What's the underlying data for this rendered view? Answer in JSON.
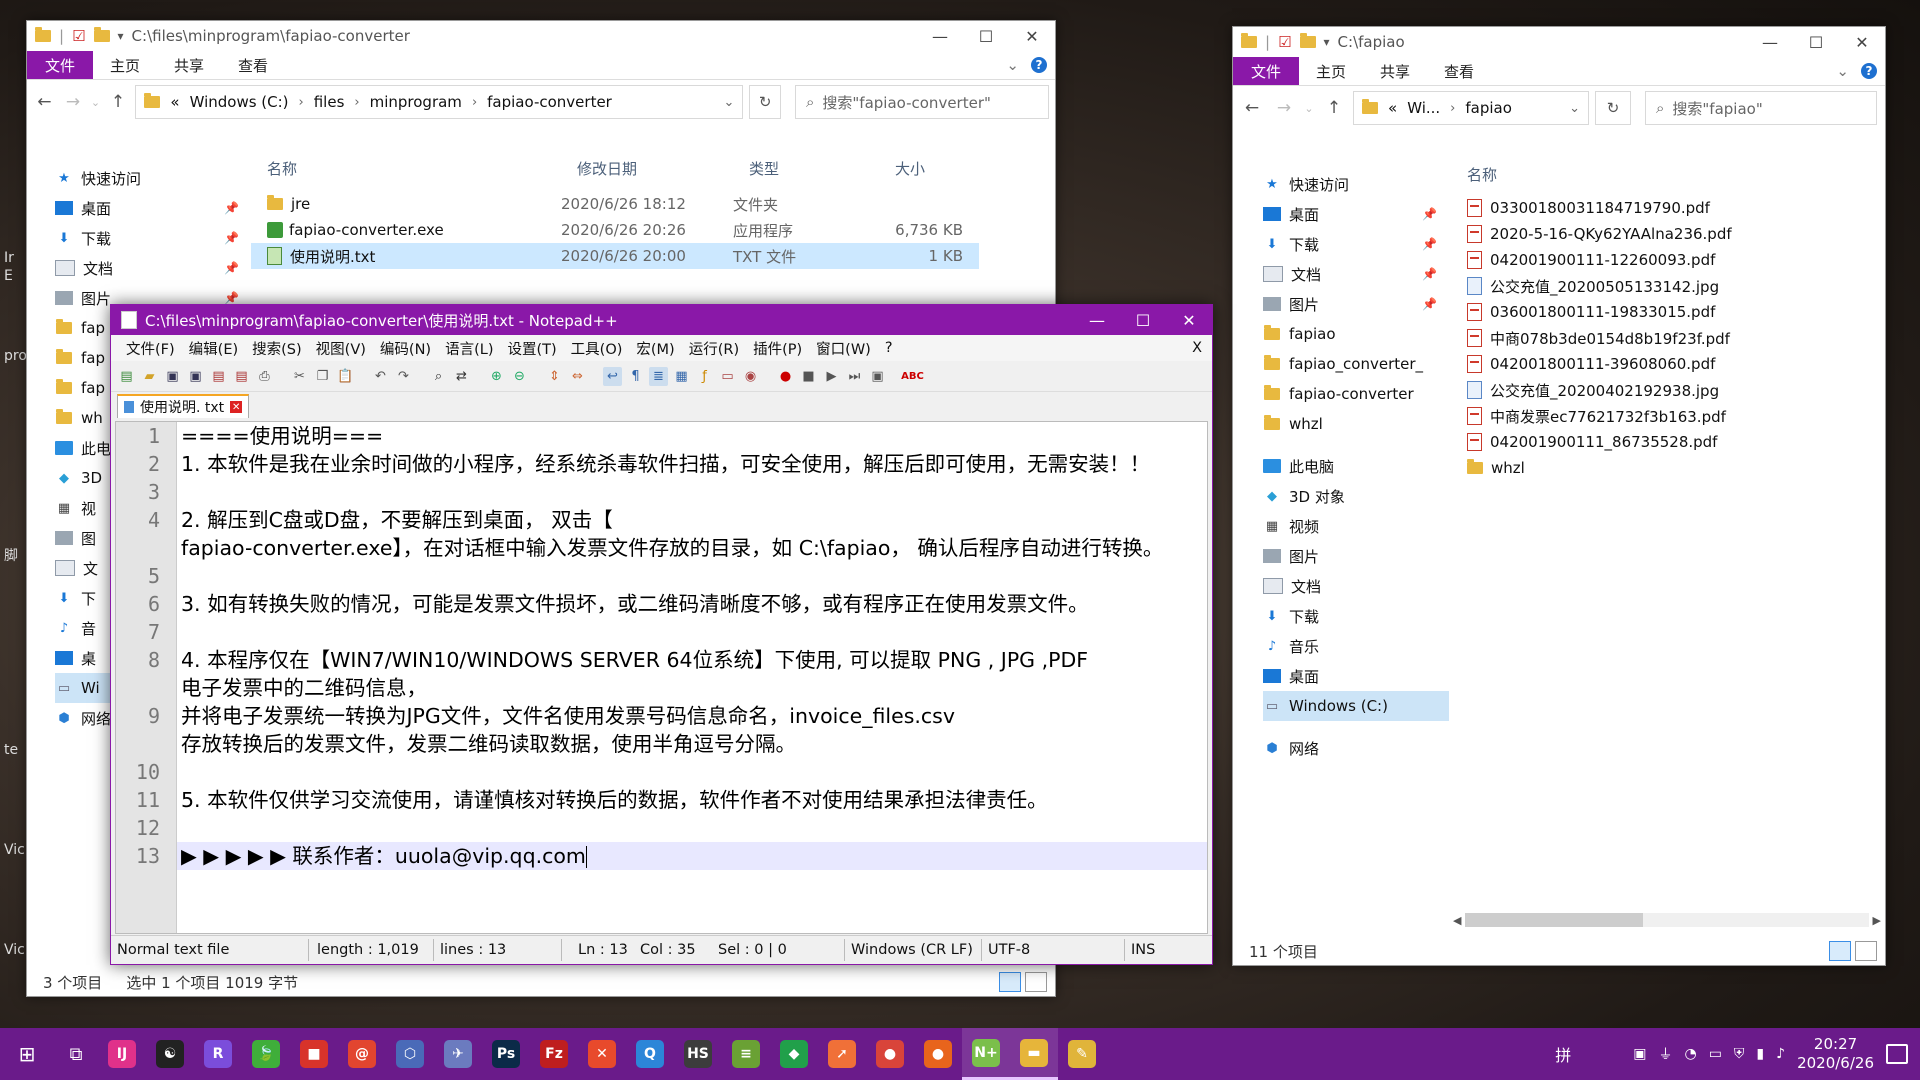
{
  "desktop": {
    "labels": [
      "Ir",
      "E",
      "pro",
      "脚",
      "te",
      "Vic",
      "Vic"
    ]
  },
  "explorer_left": {
    "title": "C:\\files\\minprogram\\fapiao-converter",
    "ribbon": {
      "file": "文件",
      "home": "主页",
      "share": "共享",
      "view": "查看"
    },
    "address": [
      "«",
      "Windows (C:)",
      "files",
      "minprogram",
      "fapiao-converter"
    ],
    "search_placeholder": "搜索\"fapiao-converter\"",
    "columns": {
      "name": "名称",
      "modified": "修改日期",
      "type": "类型",
      "size": "大小"
    },
    "files": [
      {
        "name": "jre",
        "modified": "2020/6/26 18:12",
        "type": "文件夹",
        "size": "",
        "icon": "folder-icon"
      },
      {
        "name": "fapiao-converter.exe",
        "modified": "2020/6/26 20:26",
        "type": "应用程序",
        "size": "6,736 KB",
        "icon": "exe-icon"
      },
      {
        "name": "使用说明.txt",
        "modified": "2020/6/26 20:00",
        "type": "TXT 文件",
        "size": "1 KB",
        "icon": "txt-icon",
        "selected": true
      }
    ],
    "nav": [
      {
        "label": "快速访问",
        "icon": "star-icon",
        "pin": false
      },
      {
        "label": "桌面",
        "icon": "desktop-icon",
        "pin": true
      },
      {
        "label": "下载",
        "icon": "download-icon",
        "pin": true
      },
      {
        "label": "文档",
        "icon": "document-icon",
        "pin": true
      },
      {
        "label": "图片",
        "icon": "picture-icon",
        "pin": true
      },
      {
        "label": "fap",
        "icon": "folder-icon",
        "pin": false
      },
      {
        "label": "fap",
        "icon": "folder-icon",
        "pin": false
      },
      {
        "label": "fap",
        "icon": "folder-icon",
        "pin": false
      },
      {
        "label": "wh",
        "icon": "folder-icon",
        "pin": false
      },
      {
        "label": "此电",
        "icon": "pc-icon",
        "pin": false
      },
      {
        "label": "3D",
        "icon": "cube-icon",
        "pin": false
      },
      {
        "label": "视",
        "icon": "video-icon",
        "pin": false
      },
      {
        "label": "图",
        "icon": "picture-icon",
        "pin": false
      },
      {
        "label": "文",
        "icon": "document-icon",
        "pin": false
      },
      {
        "label": "下",
        "icon": "download-icon",
        "pin": false
      },
      {
        "label": "音",
        "icon": "music-icon",
        "pin": false
      },
      {
        "label": "桌",
        "icon": "desktop-icon",
        "pin": false
      },
      {
        "label": "Wi",
        "icon": "drive-icon",
        "pin": false,
        "selected": true
      },
      {
        "label": "网络",
        "icon": "network-icon",
        "pin": false
      }
    ],
    "status": {
      "count": "3 个项目",
      "selection": "选中 1 个项目  1019 字节"
    }
  },
  "explorer_right": {
    "title": "C:\\fapiao",
    "ribbon": {
      "file": "文件",
      "home": "主页",
      "share": "共享",
      "view": "查看"
    },
    "address": [
      "«",
      "Wi...",
      "fapiao"
    ],
    "search_placeholder": "搜索\"fapiao\"",
    "columns": {
      "name": "名称"
    },
    "files": [
      {
        "name": "03300180031184719790.pdf",
        "icon": "pdf-icon"
      },
      {
        "name": "2020-5-16-QKy62YAAlna236.pdf",
        "icon": "pdf-icon"
      },
      {
        "name": "042001900111-12260093.pdf",
        "icon": "pdf-icon"
      },
      {
        "name": "公交充值_20200505133142.jpg",
        "icon": "jpg-icon"
      },
      {
        "name": "036001800111-19833015.pdf",
        "icon": "pdf-icon"
      },
      {
        "name": "中商078b3de0154d8b19f23f.pdf",
        "icon": "pdf-icon"
      },
      {
        "name": "042001800111-39608060.pdf",
        "icon": "pdf-icon"
      },
      {
        "name": "公交充值_20200402192938.jpg",
        "icon": "jpg-icon"
      },
      {
        "name": "中商发票ec77621732f3b163.pdf",
        "icon": "pdf-icon"
      },
      {
        "name": "042001900111_86735528.pdf",
        "icon": "pdf-icon"
      },
      {
        "name": "whzl",
        "icon": "folder-icon"
      }
    ],
    "nav": [
      {
        "label": "快速访问",
        "icon": "star-icon",
        "pin": false
      },
      {
        "label": "桌面",
        "icon": "desktop-icon",
        "pin": true
      },
      {
        "label": "下载",
        "icon": "download-icon",
        "pin": true
      },
      {
        "label": "文档",
        "icon": "document-icon",
        "pin": true
      },
      {
        "label": "图片",
        "icon": "picture-icon",
        "pin": true
      },
      {
        "label": "fapiao",
        "icon": "folder-icon",
        "pin": false
      },
      {
        "label": "fapiao_converter_",
        "icon": "folder-icon",
        "pin": false
      },
      {
        "label": "fapiao-converter",
        "icon": "folder-icon",
        "pin": false
      },
      {
        "label": "whzl",
        "icon": "folder-icon",
        "pin": false
      },
      {
        "label": "",
        "icon": "",
        "pin": false
      },
      {
        "label": "此电脑",
        "icon": "pc-icon",
        "pin": false
      },
      {
        "label": "3D 对象",
        "icon": "cube-icon",
        "pin": false
      },
      {
        "label": "视频",
        "icon": "video-icon",
        "pin": false
      },
      {
        "label": "图片",
        "icon": "picture-icon",
        "pin": false
      },
      {
        "label": "文档",
        "icon": "document-icon",
        "pin": false
      },
      {
        "label": "下载",
        "icon": "download-icon",
        "pin": false
      },
      {
        "label": "音乐",
        "icon": "music-icon",
        "pin": false
      },
      {
        "label": "桌面",
        "icon": "desktop-icon",
        "pin": false
      },
      {
        "label": "Windows (C:)",
        "icon": "drive-icon",
        "pin": false,
        "selected": true
      },
      {
        "label": "",
        "icon": "",
        "pin": false
      },
      {
        "label": "网络",
        "icon": "network-icon",
        "pin": false
      }
    ],
    "status": {
      "count": "11 个项目"
    }
  },
  "notepad": {
    "title": "C:\\files\\minprogram\\fapiao-converter\\使用说明.txt - Notepad++",
    "menu": [
      "文件(F)",
      "编辑(E)",
      "搜索(S)",
      "视图(V)",
      "编码(N)",
      "语言(L)",
      "设置(T)",
      "工具(O)",
      "宏(M)",
      "运行(R)",
      "插件(P)",
      "窗口(W)",
      "?"
    ],
    "close_doc": "X",
    "tab": "使用说明. txt",
    "lines": [
      {
        "num": "1",
        "text": "====使用说明==="
      },
      {
        "num": "2",
        "text": "1. 本软件是我在业余时间做的小程序，经系统杀毒软件扫描，可安全使用，解压后即可使用，无需安装！！"
      },
      {
        "num": "3",
        "text": ""
      },
      {
        "num": "4",
        "text": "2. 解压到C盘或D盘，不要解压到桌面， 双击【"
      },
      {
        "num": "",
        "text": "fapiao-converter.exe】，在对话框中输入发票文件存放的目录，如 C:\\fapiao， 确认后程序自动进行转换。"
      },
      {
        "num": "5",
        "text": ""
      },
      {
        "num": "6",
        "text": "3. 如有转换失败的情况，可能是发票文件损坏，或二维码清晰度不够，或有程序正在使用发票文件。"
      },
      {
        "num": "7",
        "text": ""
      },
      {
        "num": "8",
        "text": "4. 本程序仅在【WIN7/WIN10/WINDOWS SERVER 64位系统】下使用, 可以提取 PNG , JPG ,PDF"
      },
      {
        "num": "",
        "text": "电子发票中的二维码信息，"
      },
      {
        "num": "9",
        "text": "    并将电子发票统一转换为JPG文件，文件名使用发票号码信息命名，invoice_files.csv"
      },
      {
        "num": "",
        "text": "    存放转换后的发票文件，发票二维码读取数据，使用半角逗号分隔。"
      },
      {
        "num": "10",
        "text": ""
      },
      {
        "num": "11",
        "text": "5. 本软件仅供学习交流使用，请谨慎核对转换后的数据，软件作者不对使用结果承担法律责任。"
      },
      {
        "num": "12",
        "text": ""
      },
      {
        "num": "13",
        "text": "▶ ▶ ▶ ▶ ▶  联系作者：uuola@vip.qq.com",
        "current": true
      }
    ],
    "status": {
      "type": "Normal text file",
      "length": "length : 1,019",
      "lines": "lines : 13",
      "ln": "Ln : 13",
      "col": "Col : 35",
      "sel": "Sel : 0 | 0",
      "eol": "Windows (CR LF)",
      "encoding": "UTF-8",
      "mode": "INS"
    }
  },
  "taskbar": {
    "apps": [
      {
        "name": "idea-icon",
        "label": "IJ",
        "color": "#e0318a"
      },
      {
        "name": "yin-yang-icon",
        "label": "☯",
        "color": "#222222"
      },
      {
        "name": "rider-icon",
        "label": "R",
        "color": "#7b4ddb"
      },
      {
        "name": "leaf-icon",
        "label": "🍃",
        "color": "#3fae3a"
      },
      {
        "name": "box-icon",
        "label": "■",
        "color": "#d8332a"
      },
      {
        "name": "swirl-icon",
        "label": "@",
        "color": "#e2452f"
      },
      {
        "name": "cube-icon",
        "label": "⬡",
        "color": "#4a6ab8"
      },
      {
        "name": "bird-icon",
        "label": "✈",
        "color": "#6b7bbf"
      },
      {
        "name": "photoshop-icon",
        "label": "Ps",
        "color": "#0b2a48"
      },
      {
        "name": "filezilla-icon",
        "label": "Fz",
        "color": "#bf1e1e"
      },
      {
        "name": "xmind-icon",
        "label": "✕",
        "color": "#e84a2c"
      },
      {
        "name": "search-app-icon",
        "label": "Q",
        "color": "#2c86d8"
      },
      {
        "name": "hs-icon",
        "label": "HS",
        "color": "#3c3c3c"
      },
      {
        "name": "notes-icon",
        "label": "≡",
        "color": "#6aa134"
      },
      {
        "name": "diamond-icon",
        "label": "◆",
        "color": "#21a04a"
      },
      {
        "name": "postman-icon",
        "label": "➚",
        "color": "#f07038"
      },
      {
        "name": "chrome-icon",
        "label": "●",
        "color": "#d9443a"
      },
      {
        "name": "firefox-icon",
        "label": "●",
        "color": "#e8641c"
      },
      {
        "name": "notepadpp-icon",
        "label": "N+",
        "color": "#7bbf4b",
        "active": true
      },
      {
        "name": "explorer-icon",
        "label": "▬",
        "color": "#e6b53a",
        "active": true
      },
      {
        "name": "clipboard-icon",
        "label": "✎",
        "color": "#e0b43a"
      }
    ],
    "ime": "拼",
    "time": "20:27",
    "date": "2020/6/26"
  },
  "colors": {
    "accent": "#8a18a8",
    "taskbar": "#6a1b8a",
    "selection": "#cce8ff"
  }
}
